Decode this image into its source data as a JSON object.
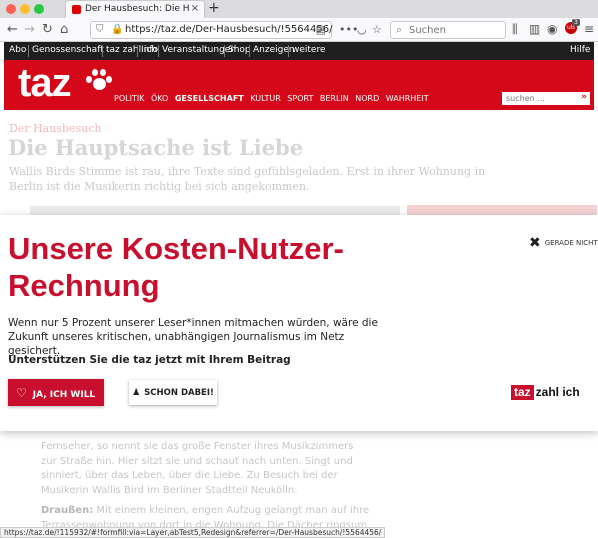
{
  "browser": {
    "tab_title": "Der Hausbesuch: Die Hauptsache",
    "tab_close": "×",
    "new_tab": "+",
    "url": "https://taz.de/Der-Hausbesuch/!5564456/",
    "more": "•••",
    "search_placeholder": "Suchen",
    "ublock_count": "3",
    "status_url": "https://taz.de/!115932/#!formfill:via=Layer,abTest5,Redesign&referrer=/Der-Hausbesuch/!5564456/"
  },
  "taz_top": {
    "items": [
      "Abo",
      "Genossenschaft",
      "taz zahl ich",
      "Info",
      "Veranstaltungen",
      "Shop",
      "Anzeigen",
      "weitere"
    ],
    "help": "Hilfe"
  },
  "taz_header": {
    "logo": "taz",
    "nav": [
      "POLITIK",
      "ÖKO",
      "GESELLSCHAFT",
      "KULTUR",
      "SPORT",
      "BERLIN",
      "NORD",
      "WAHRHEIT"
    ],
    "active_nav": "GESELLSCHAFT",
    "search_placeholder": "suchen ...",
    "search_go": "»"
  },
  "article": {
    "kicker": "Der Hausbesuch",
    "headline": "Die Hauptsache ist Liebe",
    "teaser": "Wallis Birds Stimme ist rau, ihre Texte sind gefühlsgeladen. Erst in ihrer Wohnung in Berlin ist die Musikerin richtig bei sich angekommen.",
    "para1": "Fernseher, so nennt sie das große Fenster ihres Musikzimmers zur Straße hin. Hier sitzt sie und schaut nach unten. Singt und sinniert, über das Leben, über die Liebe. Zu Besuch bei der Musikerin Wallis Bird im Berliner Stadtteil Neukölln.",
    "para2_bold": "Draußen:",
    "para2": "Mit einem kleinen, engen Aufzug gelangt man auf ihre Terrassenwohnung von dort in die Wohnung. Die Dächer ringsum in die"
  },
  "overlay": {
    "title": "Unsere Kosten-Nutzer-Rechnung",
    "not_now": "GERADE NICHT",
    "body": "Wenn nur 5 Prozent unserer Leser*innen mitmachen würden, wäre die Zukunft unseres kritischen, unabhängigen Journalismus im Netz gesichert.",
    "cta": "Unterstützen Sie die taz jetzt mit Ihrem Beitrag",
    "yes_button": "JA, ICH WILL",
    "already_button": "SCHON DABEI!",
    "brand_taz": "taz",
    "brand_zahlich": "zahl ich"
  },
  "colors": {
    "taz_red": "#d5081a",
    "overlay_red": "#c8102e",
    "top_bar": "#1f1f1f"
  }
}
